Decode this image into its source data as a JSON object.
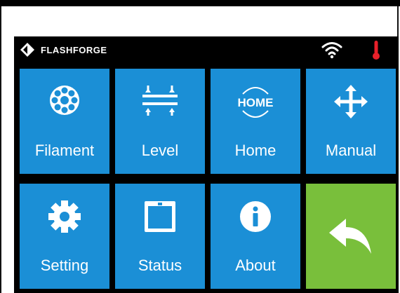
{
  "brand": {
    "name": "FLASHFORGE",
    "logo_icon": "flashforge-diamond-icon"
  },
  "status": {
    "wifi_icon": "wifi-icon",
    "temperature_icon": "thermometer-icon",
    "temperature_color": "#e8202a"
  },
  "colors": {
    "tile_blue": "#1b8fd6",
    "tile_green": "#79bf3b",
    "screen_bg": "#000000"
  },
  "menu": {
    "tiles": [
      {
        "label": "Filament",
        "icon": "filament-icon"
      },
      {
        "label": "Level",
        "icon": "level-icon"
      },
      {
        "label": "Home",
        "icon": "home-icon",
        "icon_text": "HOME"
      },
      {
        "label": "Manual",
        "icon": "move-arrows-icon"
      },
      {
        "label": "Setting",
        "icon": "gear-icon"
      },
      {
        "label": "Status",
        "icon": "status-box-icon"
      },
      {
        "label": "About",
        "icon": "info-icon"
      },
      {
        "label": "",
        "icon": "back-arrow-icon"
      }
    ]
  }
}
